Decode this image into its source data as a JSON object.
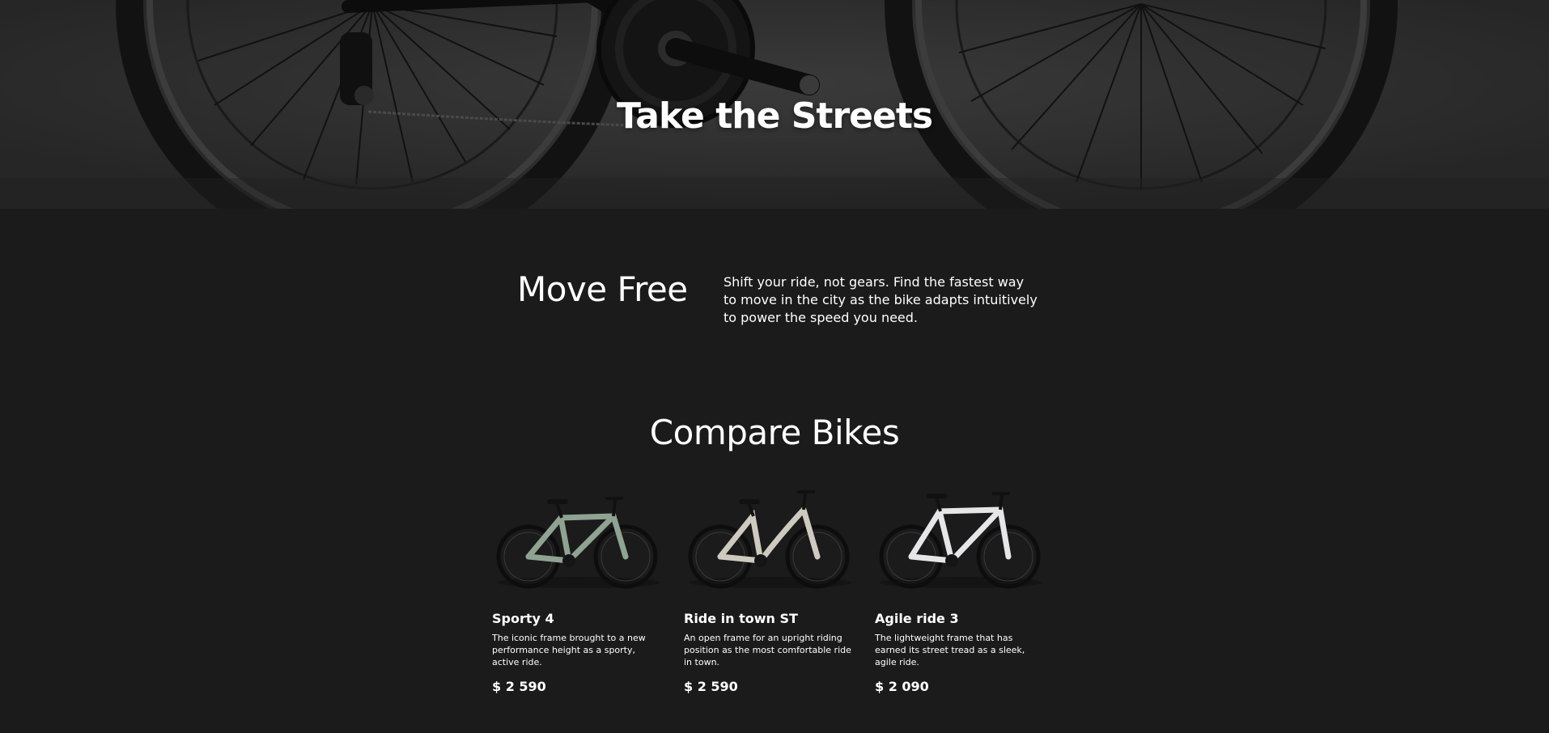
{
  "hero": {
    "title": "Take the Streets"
  },
  "intro": {
    "heading": "Move Free",
    "text": "Shift your ride, not gears. Find the fastest way to move in the city as the bike adapts intuitively to power the speed you need."
  },
  "compare": {
    "heading": "Compare Bikes",
    "bikes": [
      {
        "name": "Sporty 4",
        "description": "The iconic frame brought to a new performance height as a sporty, active ride.",
        "price": "$ 2 590",
        "frame_color": "#8fa393"
      },
      {
        "name": "Ride in town ST",
        "description": "An open frame for an upright riding position as the most comfortable ride in town.",
        "price": "$ 2 590",
        "frame_color": "#cfcac0"
      },
      {
        "name": "Agile ride 3",
        "description": "The lightweight frame that has earned its street tread as a sleek, agile ride.",
        "price": "$ 2 090",
        "frame_color": "#e6e6e8"
      }
    ]
  },
  "colors": {
    "page_background": "#1b1b1b",
    "text": "#ffffff"
  }
}
